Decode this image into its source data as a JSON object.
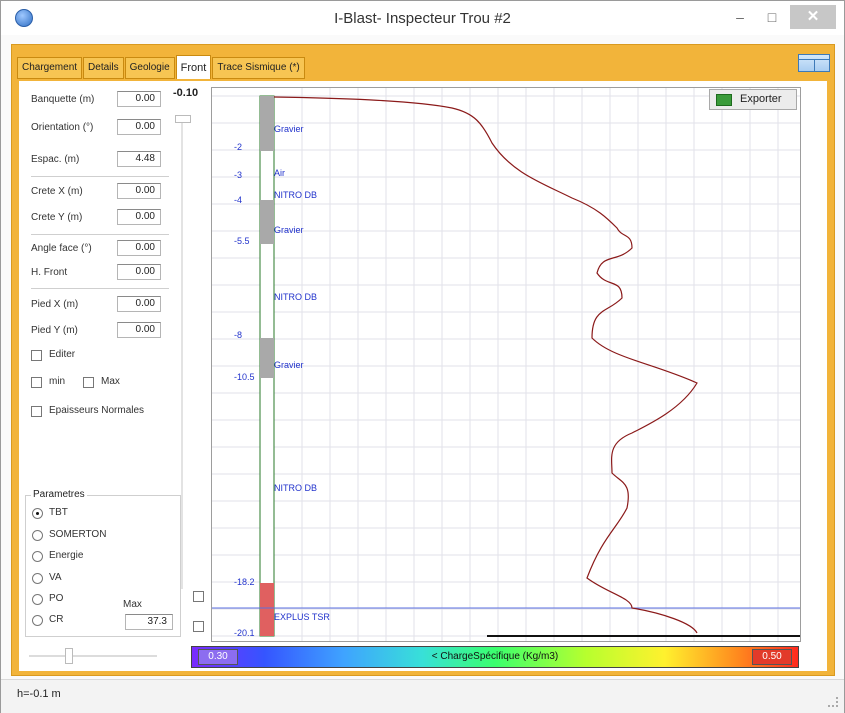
{
  "window": {
    "title": "I-Blast- Inspecteur Trou #2",
    "minimize": "–",
    "maximize": "□",
    "close": "✕"
  },
  "tabs": [
    {
      "label": "Chargement"
    },
    {
      "label": "Details"
    },
    {
      "label": "Geologie"
    },
    {
      "label": "Front"
    },
    {
      "label": "Trace Sismique (*)"
    }
  ],
  "active_tab": "Front",
  "fields": [
    {
      "label": "Banquette (m)",
      "value": "0.00"
    },
    {
      "label": "Orientation (°)",
      "value": "0.00"
    },
    {
      "label": "Espac. (m)",
      "value": "4.48"
    },
    {
      "label": "Crete X (m)",
      "value": "0.00"
    },
    {
      "label": "Crete Y (m)",
      "value": "0.00"
    },
    {
      "label": "Angle face (°)",
      "value": "0.00"
    },
    {
      "label": "H. Front",
      "value": "0.00"
    },
    {
      "label": "Pied X (m)",
      "value": "0.00"
    },
    {
      "label": "Pied Y (m)",
      "value": "0.00"
    }
  ],
  "checkboxes": {
    "editer": "Editer",
    "min": "min",
    "max": "Max",
    "epaisseurs": "Epaisseurs Normales"
  },
  "top_value": "-0.10",
  "parametres": {
    "title": "Parametres",
    "options": [
      "TBT",
      "SOMERTON",
      "Energie",
      "VA",
      "PO",
      "CR"
    ],
    "selected": "TBT",
    "max_label": "Max",
    "max_value": "37.3"
  },
  "export_button": "Exporter",
  "colorbar": {
    "min": "0.30",
    "max": "0.50",
    "title": "< ChargeSpécifique (Kg/m3)"
  },
  "status": "h=-0.1 m",
  "log": {
    "layers": [
      {
        "label": "Gravier",
        "depth_marker": "-2"
      },
      {
        "label": "Air",
        "depth_marker": "-3"
      },
      {
        "label": "NITRO DB",
        "depth_marker": "-4"
      },
      {
        "label": "Gravier",
        "depth_marker": "-5.5"
      },
      {
        "label": "NITRO DB",
        "depth_marker": "-8"
      },
      {
        "label": "Gravier",
        "depth_marker": "-10.5"
      },
      {
        "label": "NITRO DB",
        "depth_marker": "-18.2"
      },
      {
        "label": "EXPLUS TSR",
        "depth_marker": "-20.1"
      }
    ]
  },
  "colors": {
    "accent": "#f2b43a",
    "trace": "#8b1a1a",
    "layer_label": "#2233cc"
  }
}
